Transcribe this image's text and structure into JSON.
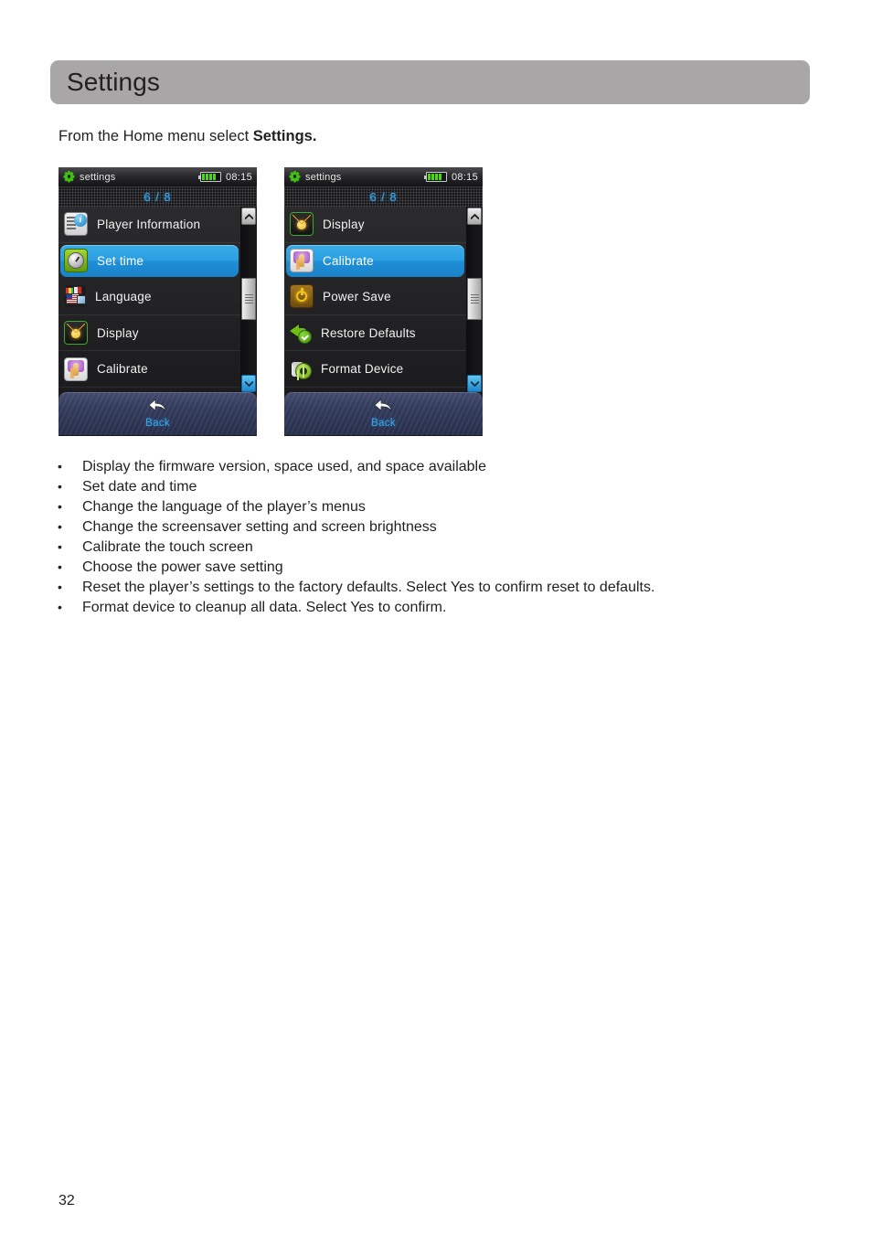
{
  "header": {
    "title": "Settings"
  },
  "intro": {
    "prefix": "From the Home menu select ",
    "bold": "Settings."
  },
  "devices": [
    {
      "status": {
        "icon": "gear-icon",
        "label": "settings",
        "battery_icon": "battery-icon",
        "battery_level": 4,
        "time": "08:15"
      },
      "page_indicator": "6 / 8",
      "items": [
        {
          "label": "Player Information",
          "icon": "player-information-icon",
          "selected": false
        },
        {
          "label": "Set time",
          "icon": "clock-icon",
          "selected": true
        },
        {
          "label": "Language",
          "icon": "flags-icon",
          "selected": false
        },
        {
          "label": "Display",
          "icon": "lightbulb-icon",
          "selected": false
        },
        {
          "label": "Calibrate",
          "icon": "touch-hand-icon",
          "selected": false
        }
      ],
      "scrollbar": {
        "up": "chevron-up-icon",
        "down": "chevron-down-icon"
      },
      "footer": {
        "icon": "back-arrow-icon",
        "label": "Back"
      }
    },
    {
      "status": {
        "icon": "gear-icon",
        "label": "settings",
        "battery_icon": "battery-icon",
        "battery_level": 4,
        "time": "08:15"
      },
      "page_indicator": "6 / 8",
      "items": [
        {
          "label": "Display",
          "icon": "lightbulb-icon",
          "selected": false
        },
        {
          "label": "Calibrate",
          "icon": "touch-hand-icon",
          "selected": true
        },
        {
          "label": "Power Save",
          "icon": "power-icon",
          "selected": false
        },
        {
          "label": "Restore Defaults",
          "icon": "restore-arrow-check-icon",
          "selected": false
        },
        {
          "label": "Format Device",
          "icon": "format-disk-icon",
          "selected": false
        }
      ],
      "scrollbar": {
        "up": "chevron-up-icon",
        "down": "chevron-down-icon"
      },
      "footer": {
        "icon": "back-arrow-icon",
        "label": "Back"
      }
    }
  ],
  "bullets": [
    {
      "marker": "•",
      "text": "Display the firmware version, space used, and space available"
    },
    {
      "marker": "•",
      "text": "Set date and time"
    },
    {
      "marker": "•",
      "text": "Change the language of the player’s menus"
    },
    {
      "marker": "•",
      "text": "Change the screensaver setting and screen brightness"
    },
    {
      "marker": "•",
      "text": "Calibrate the touch screen"
    },
    {
      "marker": "•",
      "text": "Choose the power save setting"
    },
    {
      "marker": "•",
      "text": "Reset the player’s settings to the factory defaults. Select Yes to confirm reset to defaults."
    },
    {
      "marker": "•",
      "text": "Format device to cleanup all data. Select Yes to confirm."
    }
  ],
  "footer": {
    "page_number": "32"
  },
  "colors": {
    "header_bg": "#a9a6a7",
    "selection_blue": "#2a9ee1",
    "accent_cyan": "#3aa8e8",
    "battery_green": "#49d914",
    "text": "#231f20"
  }
}
